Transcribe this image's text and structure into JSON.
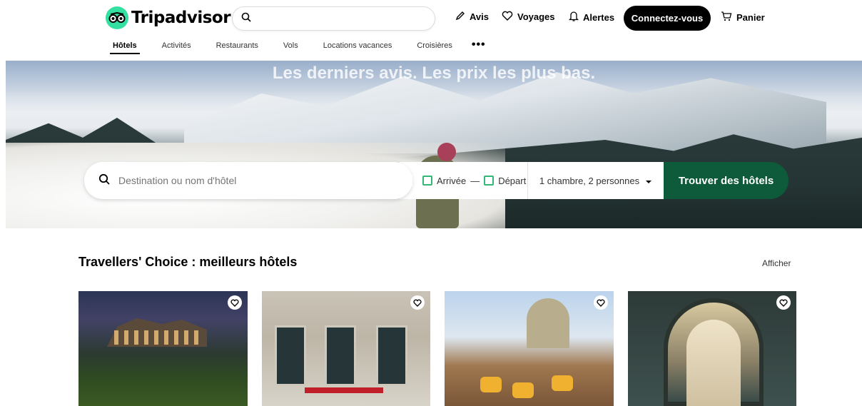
{
  "header": {
    "logo_text": "Tripadvisor",
    "search_placeholder": "",
    "actions": {
      "reviews": "Avis",
      "trips": "Voyages",
      "alerts": "Alertes",
      "cart": "Panier"
    },
    "signin_label": "Connectez-vous"
  },
  "tabs": [
    {
      "label": "Hôtels",
      "active": true
    },
    {
      "label": "Activités"
    },
    {
      "label": "Restaurants"
    },
    {
      "label": "Vols"
    },
    {
      "label": "Locations vacances"
    },
    {
      "label": "Croisières"
    }
  ],
  "tabs_more": "•••",
  "hero": {
    "title": "Les derniers avis. Les prix les plus bas.",
    "destination_placeholder": "Destination ou nom d'hôtel",
    "checkin": "Arrivée",
    "dash": "—",
    "checkout": "Départ",
    "guests": "1 chambre, 2 personnes",
    "find_label": "Trouver des hôtels"
  },
  "section": {
    "title": "Travellers' Choice : meilleurs hôtels",
    "show_link": "Afficher"
  },
  "colors": {
    "brand_green": "#34e0a1",
    "cta_green": "#0d5b3a",
    "black": "#000000"
  },
  "icons": {
    "search": "search-icon",
    "reviews": "pencil-icon",
    "trips": "heart-icon",
    "alerts": "bell-icon",
    "cart": "cart-icon",
    "calendar": "calendar-icon",
    "dropdown": "caret-down-icon",
    "save": "heart-icon"
  }
}
